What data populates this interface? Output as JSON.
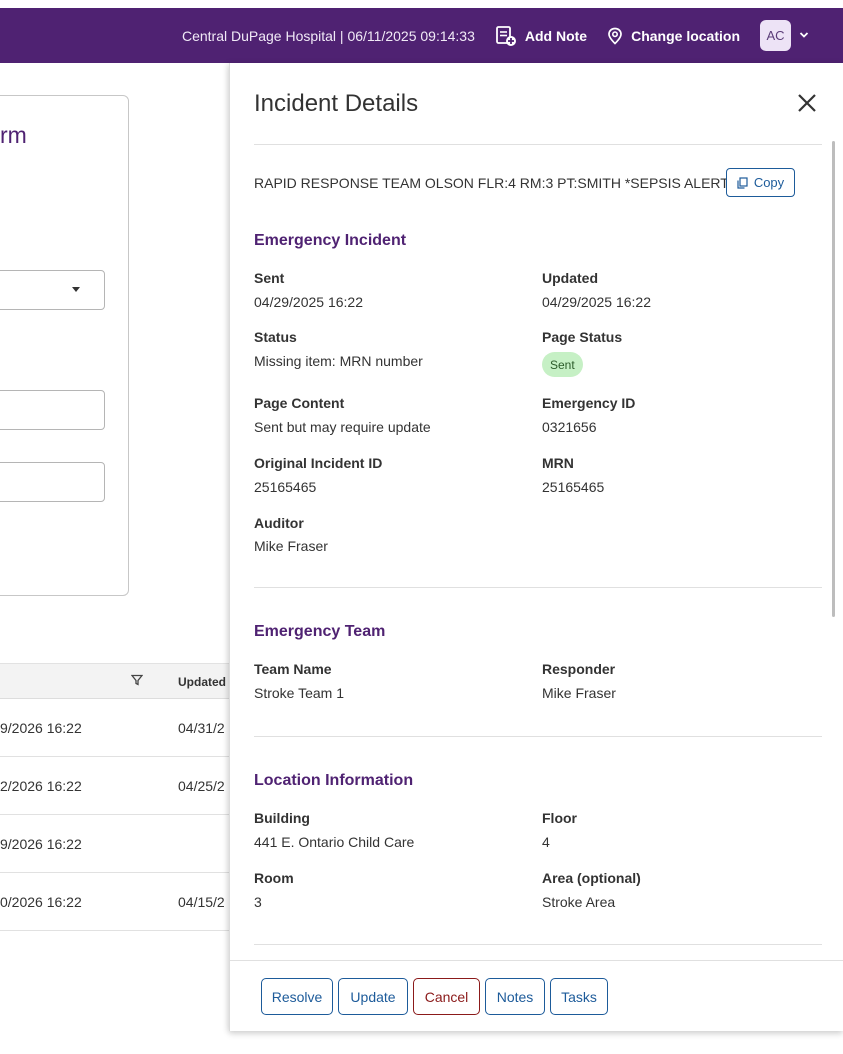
{
  "topbar": {
    "site_info": "Central DuPage Hospital | 06/11/2025 09:14:33",
    "add_note": "Add Note",
    "change_location": "Change location",
    "avatar_initials": "AC",
    "color": "#4f2272"
  },
  "background": {
    "form_title_fragment": "rm",
    "table": {
      "updated_header": "Updated",
      "rows": [
        {
          "sent": "9/2026 16:22",
          "updated": "04/31/2"
        },
        {
          "sent": "2/2026 16:22",
          "updated": "04/25/2"
        },
        {
          "sent": "9/2026 16:22",
          "updated": ""
        },
        {
          "sent": "0/2026 16:22",
          "updated": "04/15/2"
        }
      ]
    }
  },
  "panel": {
    "title": "Incident Details",
    "alert_text": "RAPID RESPONSE TEAM OLSON FLR:4 RM:3 PT:SMITH *SEPSIS ALERT",
    "copy_label": "Copy",
    "emergency_incident": {
      "title": "Emergency Incident",
      "sent_label": "Sent",
      "sent_value": "04/29/2025 16:22",
      "updated_label": "Updated",
      "updated_value": "04/29/2025 16:22",
      "status_label": "Status",
      "status_value": "Missing item: MRN number",
      "page_status_label": "Page Status",
      "page_status_value": "Sent",
      "page_content_label": "Page Content",
      "page_content_value": "Sent but may require update",
      "emergency_id_label": "Emergency ID",
      "emergency_id_value": "0321656",
      "original_id_label": "Original Incident ID",
      "original_id_value": "25165465",
      "mrn_label": "MRN",
      "mrn_value": "25165465",
      "auditor_label": "Auditor",
      "auditor_value": "Mike Fraser"
    },
    "emergency_team": {
      "title": "Emergency Team",
      "team_name_label": "Team Name",
      "team_name_value": "Stroke Team 1",
      "responder_label": "Responder",
      "responder_value": "Mike Fraser"
    },
    "location": {
      "title": "Location Information",
      "building_label": "Building",
      "building_value": "441 E. Ontario Child Care",
      "floor_label": "Floor",
      "floor_value": "4",
      "room_label": "Room",
      "room_value": "3",
      "area_label": "Area (optional)",
      "area_value": "Stroke Area"
    },
    "footer": {
      "resolve": "Resolve",
      "update": "Update",
      "cancel": "Cancel",
      "notes": "Notes",
      "tasks": "Tasks"
    }
  }
}
